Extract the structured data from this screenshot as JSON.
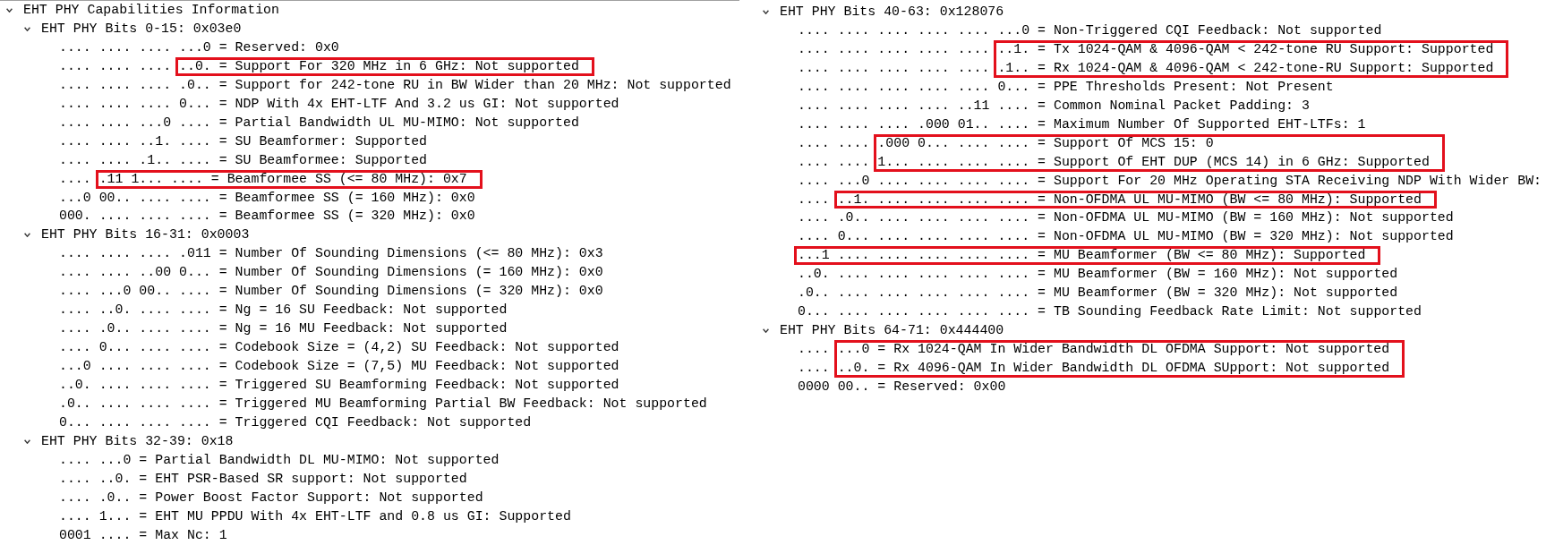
{
  "panels": [
    {
      "tree": [
        {
          "kind": "node",
          "label": "EHT PHY Capabilities Information",
          "expanded": true,
          "children": [
            {
              "kind": "node",
              "label": "EHT PHY Bits 0-15: 0x03e0",
              "expanded": true,
              "children": [
                {
                  "kind": "field",
                  "text": ".... .... .... ...0 = Reserved: 0x0"
                },
                {
                  "kind": "highlight",
                  "rows": [
                    {
                      "lead": ".... .... ....",
                      "text": "..0. = Support For 320 MHz in 6 GHz: Not supported"
                    }
                  ]
                },
                {
                  "kind": "field",
                  "text": ".... .... .... .0.. = Support for 242-tone RU in BW Wider than 20 MHz: Not supported"
                },
                {
                  "kind": "field",
                  "text": ".... .... .... 0... = NDP With 4x EHT-LTF And 3.2 us GI: Not supported"
                },
                {
                  "kind": "field",
                  "text": ".... .... ...0 .... = Partial Bandwidth UL MU-MIMO: Not supported"
                },
                {
                  "kind": "field",
                  "text": ".... .... ..1. .... = SU Beamformer: Supported"
                },
                {
                  "kind": "field",
                  "text": ".... .... .1.. .... = SU Beamformee: Supported"
                },
                {
                  "kind": "highlight",
                  "rows": [
                    {
                      "lead": "....",
                      "text": ".11 1... .... = Beamformee SS (<= 80 MHz): 0x7"
                    }
                  ]
                },
                {
                  "kind": "field",
                  "text": "...0 00.. .... .... = Beamformee SS (= 160 MHz): 0x0"
                },
                {
                  "kind": "field",
                  "text": "000. .... .... .... = Beamformee SS (= 320 MHz): 0x0"
                }
              ]
            },
            {
              "kind": "node",
              "label": "EHT PHY Bits 16-31: 0x0003",
              "expanded": true,
              "children": [
                {
                  "kind": "field",
                  "text": ".... .... .... .011 = Number Of Sounding Dimensions (<= 80 MHz): 0x3"
                },
                {
                  "kind": "field",
                  "text": ".... .... ..00 0... = Number Of Sounding Dimensions (= 160 MHz): 0x0"
                },
                {
                  "kind": "field",
                  "text": ".... ...0 00.. .... = Number Of Sounding Dimensions (= 320 MHz): 0x0"
                },
                {
                  "kind": "field",
                  "text": ".... ..0. .... .... = Ng = 16 SU Feedback: Not supported"
                },
                {
                  "kind": "field",
                  "text": ".... .0.. .... .... = Ng = 16 MU Feedback: Not supported"
                },
                {
                  "kind": "field",
                  "text": ".... 0... .... .... = Codebook Size = (4,2) SU Feedback: Not supported"
                },
                {
                  "kind": "field",
                  "text": "...0 .... .... .... = Codebook Size = (7,5) MU Feedback: Not supported"
                },
                {
                  "kind": "field",
                  "text": "..0. .... .... .... = Triggered SU Beamforming Feedback: Not supported"
                },
                {
                  "kind": "field",
                  "text": ".0.. .... .... .... = Triggered MU Beamforming Partial BW Feedback: Not supported"
                },
                {
                  "kind": "field",
                  "text": "0... .... .... .... = Triggered CQI Feedback: Not supported"
                }
              ]
            },
            {
              "kind": "node",
              "label": "EHT PHY Bits 32-39: 0x18",
              "expanded": true,
              "children": [
                {
                  "kind": "field",
                  "text": ".... ...0 = Partial Bandwidth DL MU-MIMO: Not supported"
                },
                {
                  "kind": "field",
                  "text": ".... ..0. = EHT PSR-Based SR support: Not supported"
                },
                {
                  "kind": "field",
                  "text": ".... .0.. = Power Boost Factor Support: Not supported"
                },
                {
                  "kind": "field",
                  "text": ".... 1... = EHT MU PPDU With 4x EHT-LTF and 0.8 us GI: Supported"
                },
                {
                  "kind": "field",
                  "text": "0001 .... = Max Nc: 1"
                }
              ]
            }
          ]
        }
      ]
    },
    {
      "tree": [
        {
          "kind": "node",
          "label": "EHT PHY Bits 40-63: 0x128076",
          "expanded": true,
          "children": [
            {
              "kind": "field",
              "text": ".... .... .... .... .... ...0 = Non-Triggered CQI Feedback: Not supported"
            },
            {
              "kind": "highlight",
              "rows": [
                {
                  "lead": ".... .... .... .... ....",
                  "text": "..1. = Tx 1024-QAM & 4096-QAM < 242-tone RU Support: Supported"
                },
                {
                  "lead": ".... .... .... .... ....",
                  "text": ".1.. = Rx 1024-QAM & 4096-QAM < 242-tone-RU Support: Supported"
                }
              ]
            },
            {
              "kind": "field",
              "text": ".... .... .... .... .... 0... = PPE Thresholds Present: Not Present"
            },
            {
              "kind": "field",
              "text": ".... .... .... .... ..11 .... = Common Nominal Packet Padding: 3"
            },
            {
              "kind": "field",
              "text": ".... .... .... .000 01.. .... = Maximum Number Of Supported EHT-LTFs: 1"
            },
            {
              "kind": "highlight",
              "rows": [
                {
                  "lead": ".... ....",
                  "text": ".000 0... .... .... = Support Of MCS 15: 0"
                },
                {
                  "lead": ".... ....",
                  "text": "1... .... .... .... = Support Of EHT DUP (MCS 14) in 6 GHz: Supported"
                }
              ]
            },
            {
              "kind": "field",
              "text": ".... ...0 .... .... .... .... = Support For 20 MHz Operating STA Receiving NDP With Wider BW:"
            },
            {
              "kind": "highlight",
              "rows": [
                {
                  "lead": "....",
                  "text": "..1. .... .... .... .... = Non-OFDMA UL MU-MIMO (BW <= 80 MHz): Supported"
                }
              ]
            },
            {
              "kind": "field",
              "text": ".... .0.. .... .... .... .... = Non-OFDMA UL MU-MIMO (BW = 160 MHz): Not supported"
            },
            {
              "kind": "field",
              "text": ".... 0... .... .... .... .... = Non-OFDMA UL MU-MIMO (BW = 320 MHz): Not supported"
            },
            {
              "kind": "highlight",
              "rows": [
                {
                  "text": "...1 .... .... .... .... .... = MU Beamformer (BW <= 80 MHz): Supported"
                }
              ]
            },
            {
              "kind": "field",
              "text": "..0. .... .... .... .... .... = MU Beamformer (BW = 160 MHz): Not supported"
            },
            {
              "kind": "field",
              "text": ".0.. .... .... .... .... .... = MU Beamformer (BW = 320 MHz): Not supported"
            },
            {
              "kind": "field",
              "text": "0... .... .... .... .... .... = TB Sounding Feedback Rate Limit: Not supported"
            }
          ]
        },
        {
          "kind": "node",
          "label": "EHT PHY Bits 64-71: 0x444400",
          "expanded": true,
          "children": [
            {
              "kind": "highlight",
              "rows": [
                {
                  "lead": "....",
                  "text": "...0 = Rx 1024-QAM In Wider Bandwidth DL OFDMA Support: Not supported"
                },
                {
                  "lead": "....",
                  "text": "..0. = Rx 4096-QAM In Wider Bandwidth DL OFDMA SUpport: Not supported"
                }
              ]
            },
            {
              "kind": "field",
              "text": "0000 00.. = Reserved: 0x00"
            }
          ]
        }
      ]
    }
  ]
}
